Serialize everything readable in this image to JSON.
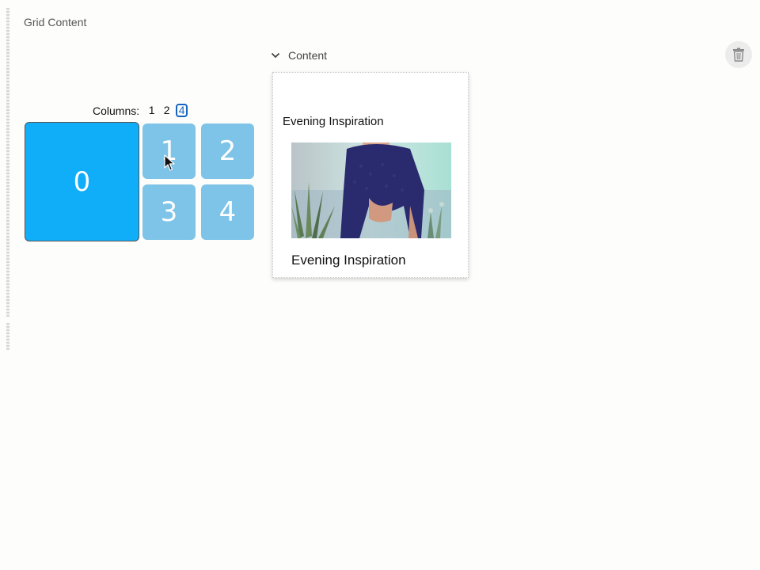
{
  "grid": {
    "title": "Grid Content",
    "columns_label": "Columns:",
    "column_options": [
      "1",
      "2",
      "4"
    ],
    "selected_columns": "4",
    "tiles": [
      "0",
      "1",
      "2",
      "3",
      "4"
    ],
    "colors": {
      "selected_tile": "#10adf9",
      "tile": "#7ec3e8",
      "active_option": "#1565c0"
    }
  },
  "content": {
    "toggle_label": "Content",
    "card": {
      "heading": "Evening Inspiration",
      "caption": "Evening Inspiration"
    }
  },
  "icons": {
    "toggle": "chevron-down-icon",
    "delete": "trash-icon",
    "cursor": "mouse-pointer-icon"
  }
}
